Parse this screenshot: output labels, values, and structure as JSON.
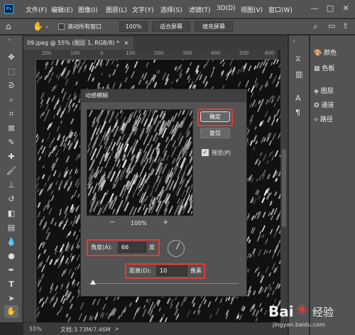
{
  "app": {
    "logo": "Ps"
  },
  "menubar": {
    "items": [
      "文件(F)",
      "编辑(E)",
      "图像(I)",
      "图层(L)",
      "文字(Y)",
      "选择(S)",
      "滤镜(T)",
      "3D(D)",
      "视图(V)",
      "窗口(W)"
    ]
  },
  "window_controls": {
    "minimize": "—",
    "maximize": "□",
    "close": "✕"
  },
  "options_bar": {
    "scroll_all_label": "滚动所有窗口",
    "zoom_value": "100%",
    "fit_screen": "适合屏幕",
    "fill_screen": "填充屏幕"
  },
  "document": {
    "tab_label": "09.jpeg @ 55% (图层 1, RGB/8) *",
    "close": "×"
  },
  "rulers": {
    "h_ticks": [
      "200",
      "100",
      "0",
      "100",
      "200",
      "300",
      "400",
      "500",
      "600"
    ]
  },
  "status": {
    "zoom": "55%",
    "doc_info": "文档:3.73M/7.46M",
    "arrow": ">"
  },
  "panels": {
    "items": [
      {
        "icon": "palette-icon",
        "label": "颜色"
      },
      {
        "icon": "swatches-icon",
        "label": "色板"
      },
      {
        "icon": "layers-icon",
        "label": "图层"
      },
      {
        "icon": "channels-icon",
        "label": "通道"
      },
      {
        "icon": "paths-icon",
        "label": "路径"
      }
    ]
  },
  "dialog": {
    "title": "动感模糊",
    "ok_label": "确定",
    "reset_label": "复位",
    "preview_label": "预览(P)",
    "preview_checked": true,
    "zoom_out": "−",
    "zoom_in": "+",
    "zoom_value": "100%",
    "angle_label": "角度(A):",
    "angle_value": "66",
    "angle_unit": "度",
    "distance_label": "距离(D):",
    "distance_value": "10",
    "distance_unit": "像素"
  },
  "watermark": {
    "brand": "Bai",
    "brand_suffix": "经验",
    "url": "jingyan.baidu.com"
  },
  "colors": {
    "highlight": "#e23b3b",
    "panel_bg": "#535353",
    "canvas_bg": "#111111"
  }
}
